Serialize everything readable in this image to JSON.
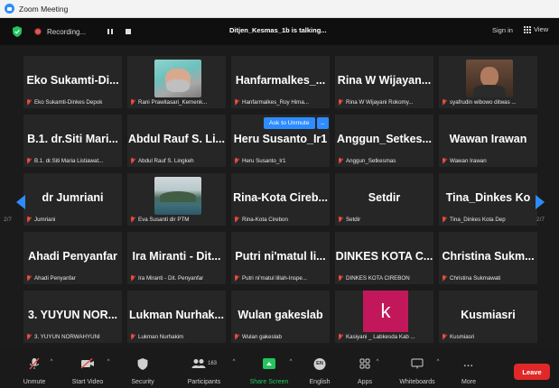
{
  "window": {
    "title": "Zoom Meeting"
  },
  "topbar": {
    "recording_label": "Recording...",
    "talking": "Ditjen_Kesmas_1b is talking...",
    "signin": "Sign in",
    "view": "View"
  },
  "tiles": [
    {
      "big": "Eko Sukamti-Di...",
      "name": "Eko Sukamti-Dinkes Depok"
    },
    {
      "big": "",
      "name": "Rani Prawitasari_Kemenk..."
    },
    {
      "big": "Hanfarmalkes_...",
      "name": "Hanfarmalkes_Roy Hima..."
    },
    {
      "big": "Rina W Wijayan...",
      "name": "Rina W Wijayani Rokomy..."
    },
    {
      "big": "",
      "name": "syafrudin wibowo ditwas ..."
    },
    {
      "big": "B.1. dr.Siti Mari...",
      "name": "B.1. dr.Siti Maria Listiawat..."
    },
    {
      "big": "Abdul Rauf S. Li...",
      "name": "Abdul Rauf S. Lingkeh"
    },
    {
      "big": "Heru Susanto_Ir1",
      "name": "Heru Susanto_Ir1"
    },
    {
      "big": "Anggun_Setkes...",
      "name": "Anggun_Setkesmas"
    },
    {
      "big": "Wawan Irawan",
      "name": "Wawan Irawan"
    },
    {
      "big": "dr Jumriani",
      "name": "Jumriani"
    },
    {
      "big": "",
      "name": "Eva Susanti dir PTM"
    },
    {
      "big": "Rina-Kota Cireb...",
      "name": "Rina-Kota Cirebon"
    },
    {
      "big": "Setdir",
      "name": "Setdir"
    },
    {
      "big": "Tina_Dinkes Ko",
      "name": "Tina_Dinkes Kota Dep"
    },
    {
      "big": "Ahadi Penyanfar",
      "name": "Ahadi Penyanfar"
    },
    {
      "big": "Ira Miranti - Dit...",
      "name": "Ira Miranti - Dit. Penyanfar"
    },
    {
      "big": "Putri ni'matul li...",
      "name": "Putri ni'matul lillah-Inspe..."
    },
    {
      "big": "DINKES KOTA C...",
      "name": "DINKES KOTA CIREBON"
    },
    {
      "big": "Christina Sukm...",
      "name": "Christina Sukmawati"
    },
    {
      "big": "3. YUYUN NOR...",
      "name": "3. YUYUN NORWAHYUNI"
    },
    {
      "big": "Lukman Nurhak...",
      "name": "Lukman Nurhakim"
    },
    {
      "big": "Wulan gakeslab",
      "name": "Wulan gakeslab"
    },
    {
      "big": "",
      "name": "Kasiyani _ Labkesda Kab ..."
    },
    {
      "big": "Kusmiasri",
      "name": "Kusmiasri"
    }
  ],
  "avatar_letter": "k",
  "overlay": {
    "ask_unmute": "Ask to Unmute",
    "more": "..."
  },
  "pagination": {
    "left": "2/7",
    "right": "2/7"
  },
  "toolbar": {
    "unmute": "Unmute",
    "start_video": "Start Video",
    "security": "Security",
    "participants": "Participants",
    "participant_count": "163",
    "share_screen": "Share Screen",
    "english": "English",
    "english_badge": "EN",
    "apps": "Apps",
    "whiteboards": "Whiteboards",
    "more": "More",
    "more_icon": "...",
    "leave": "Leave"
  },
  "colors": {
    "accent": "#2d8cff",
    "share": "#22c55e",
    "leave": "#e02828",
    "avatar": "#c2185b",
    "muted": "#e74c3c"
  }
}
